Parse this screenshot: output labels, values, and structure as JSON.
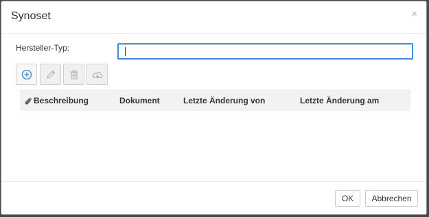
{
  "dialog": {
    "title": "Synoset",
    "close_glyph": "×"
  },
  "form": {
    "manufacturer_type_label": "Hersteller-Typ:",
    "manufacturer_type_value": "",
    "manufacturer_type_placeholder": ""
  },
  "toolbar": {
    "buttons": [
      {
        "icon": "add-circle-icon",
        "enabled": true
      },
      {
        "icon": "pencil-icon",
        "enabled": false
      },
      {
        "icon": "trash-icon",
        "enabled": false
      },
      {
        "icon": "cloud-download-icon",
        "enabled": false
      }
    ]
  },
  "table": {
    "columns": [
      "Beschreibung",
      "Dokument",
      "Letzte Änderung von",
      "Letzte Änderung am"
    ],
    "rows": []
  },
  "footer": {
    "ok_label": "OK",
    "cancel_label": "Abbrechen"
  },
  "colors": {
    "accent": "#3a8ee0",
    "overlay": "#4a4a4a"
  }
}
